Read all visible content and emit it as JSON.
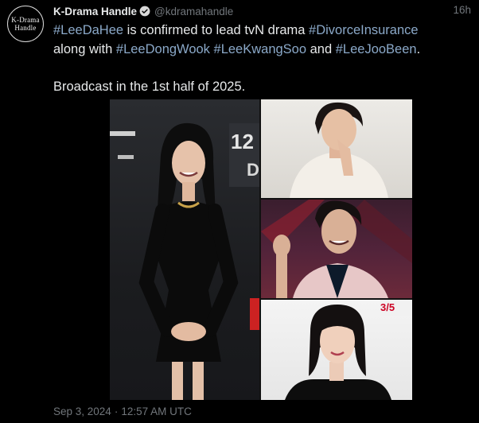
{
  "author": {
    "avatar_line1": "K-Drama",
    "avatar_line2": "Handle",
    "display_name": "K-Drama Handle",
    "username": "@kdramahandle",
    "time_ago": "16h",
    "verified_icon": "verified-badge-icon"
  },
  "tweet": {
    "tag1": "#LeeDaHee",
    "text1": " is confirmed to lead tvN drama ",
    "tag2": "#DivorceInsurance",
    "text2": "along with ",
    "tag3": "#LeeDongWook",
    "tag4": "#LeeKwangSoo",
    "text3": " and ",
    "tag5": "#LeeJooBeen",
    "text4": ".",
    "line2": "Broadcast in the 1st half of 2025."
  },
  "media": {
    "photos": [
      {
        "name": "photo-lee-da-hee"
      },
      {
        "name": "photo-lee-dong-wook"
      },
      {
        "name": "photo-lee-kwang-soo"
      },
      {
        "name": "photo-lee-joo-been"
      }
    ]
  },
  "footer": {
    "date": "Sep 3, 2024",
    "separator": "·",
    "time": "12:57 AM UTC"
  },
  "colors": {
    "background": "#000000",
    "text": "#e7e9ea",
    "hashtag": "#8ba9c9",
    "muted": "#71767b",
    "verified": "#1d9bf0"
  }
}
